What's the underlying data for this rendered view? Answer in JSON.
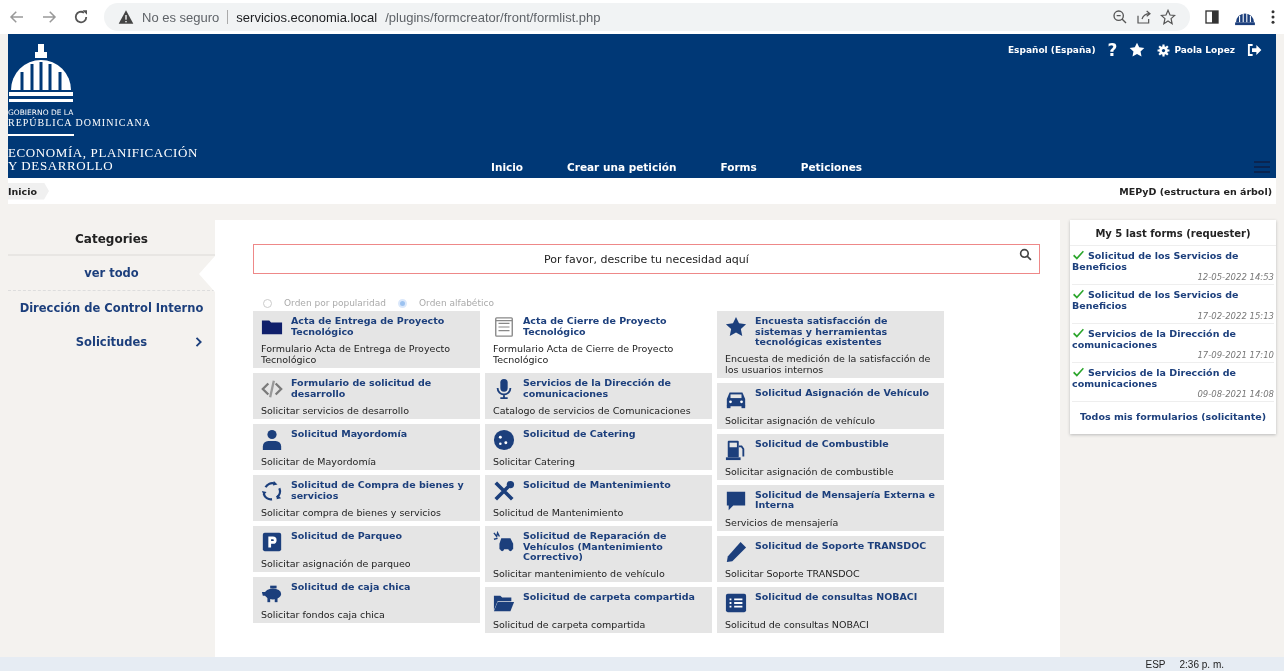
{
  "browser": {
    "security": "No es seguro",
    "url_host": "servicios.economia.local",
    "url_path": "/plugins/formcreator/front/formlist.php"
  },
  "header": {
    "logo": {
      "line_1": "GOBIERNO DE LA",
      "line_2": "REPÚBLICA DOMINICANA",
      "line_3": "ECONOMÍA, PLANIFICACIÓN",
      "line_4": "Y DESARROLLO"
    },
    "language": "Español (España)",
    "help": "?",
    "user": "Paola Lopez",
    "nav": [
      {
        "label": "Inicio"
      },
      {
        "label": "Crear una petición"
      },
      {
        "label": "Forms"
      },
      {
        "label": "Peticiones"
      }
    ]
  },
  "breadcrumb": {
    "current": "Inicio",
    "entity": "MEPyD (estructura en árbol)"
  },
  "categories": {
    "title": "Categories",
    "items": [
      {
        "label": "ver todo",
        "selected": true,
        "has_children": false
      },
      {
        "label": "Dirección de Control Interno",
        "selected": false,
        "has_children": false
      },
      {
        "label": "Solicitudes",
        "selected": false,
        "has_children": true
      }
    ]
  },
  "search": {
    "placeholder": "Por favor, describe tu necesidad aquí"
  },
  "sort_options": [
    {
      "label": "Orden por popularidad",
      "selected": false
    },
    {
      "label": "Orden alfabético",
      "selected": true
    }
  ],
  "form_columns": [
    [
      {
        "kind": "folder",
        "title": "Acta de Entrega de Proyecto Tecnológico",
        "description": "Formulario Acta de Entrega de Proyecto Tecnológico",
        "highlighted": false
      },
      {
        "kind": "code",
        "title": "Formulario de solicitud de desarrollo",
        "description": "Solicitar servicios de desarrollo",
        "highlighted": false
      },
      {
        "kind": "person",
        "title": "Solicitud Mayordomía",
        "description": "Solicitar de Mayordomía",
        "highlighted": false
      },
      {
        "kind": "cycle",
        "title": "Solicitud de Compra de bienes y servicios",
        "description": "Solicitar compra de bienes y servicios",
        "highlighted": false
      },
      {
        "kind": "parking",
        "title": "Solicitud de Parqueo",
        "description": "Solicitar asignación de parqueo",
        "highlighted": false
      },
      {
        "kind": "piggy",
        "title": "Solicitud de caja chica",
        "description": "Solicitar fondos caja chica",
        "highlighted": false
      }
    ],
    [
      {
        "kind": "form",
        "title": "Acta de Cierre de Proyecto Tecnológico",
        "description": "Formulario Acta de Cierre de Proyecto Tecnológico",
        "highlighted": true
      },
      {
        "kind": "microphone",
        "title": "Servicios de la Dirección de comunicaciones",
        "description": "Catalogo de servicios de Comunicaciones",
        "highlighted": false
      },
      {
        "kind": "cookie",
        "title": "Solicitud de Catering",
        "description": "Solicitar Catering",
        "highlighted": false
      },
      {
        "kind": "tools",
        "title": "Solicitud de Mantenimiento",
        "description": "Solicitud de Mantenimiento",
        "highlighted": false
      },
      {
        "kind": "car-crash",
        "title": "Solicitud de Reparación de Vehículos (Mantenimiento Correctivo)",
        "description": "Solicitar mantenimiento de vehículo",
        "highlighted": false
      },
      {
        "kind": "folder-open",
        "title": "Solicitud de carpeta compartida",
        "description": "Solicitud de carpeta compartida",
        "highlighted": false
      }
    ],
    [
      {
        "kind": "star",
        "title": "Encuesta satisfacción de sistemas y herramientas tecnológicas existentes",
        "description": "Encuesta de medición de la satisfacción de los usuarios internos",
        "highlighted": false
      },
      {
        "kind": "car",
        "title": "Solicitud Asignación de Vehículo",
        "description": "Solicitar asignación de vehículo",
        "highlighted": false
      },
      {
        "kind": "fuel",
        "title": "Solicitud de Combustible",
        "description": "Solicitar asignación de combustible",
        "highlighted": false
      },
      {
        "kind": "comment",
        "title": "Solicitud de Mensajería Externa e Interna",
        "description": "Servicios de mensajería",
        "highlighted": false
      },
      {
        "kind": "pencil",
        "title": "Solicitud de Soporte TRANSDOC",
        "description": "Solicitar Soporte TRANSDOC",
        "highlighted": false
      },
      {
        "kind": "list",
        "title": "Solicitud de consultas NOBACI",
        "description": "Solicitud de consultas NOBACI",
        "highlighted": false
      }
    ]
  ],
  "last_forms": {
    "title": "My 5 last forms (requester)",
    "items": [
      {
        "title": "Solicitud de los Servicios de Beneficios",
        "date": "12-05-2022 14:53"
      },
      {
        "title": "Solicitud de los Servicios de Beneficios",
        "date": "17-02-2022 15:13"
      },
      {
        "title": "Servicios de la Dirección de comunicaciones",
        "date": "17-09-2021 17:10"
      },
      {
        "title": "Servicios de la Dirección de comunicaciones",
        "date": "09-08-2021 14:08"
      }
    ],
    "footer_link": "Todos mis formularios (solicitante)"
  },
  "taskbar": {
    "language": "ESP",
    "time": "2:36 p. m."
  }
}
